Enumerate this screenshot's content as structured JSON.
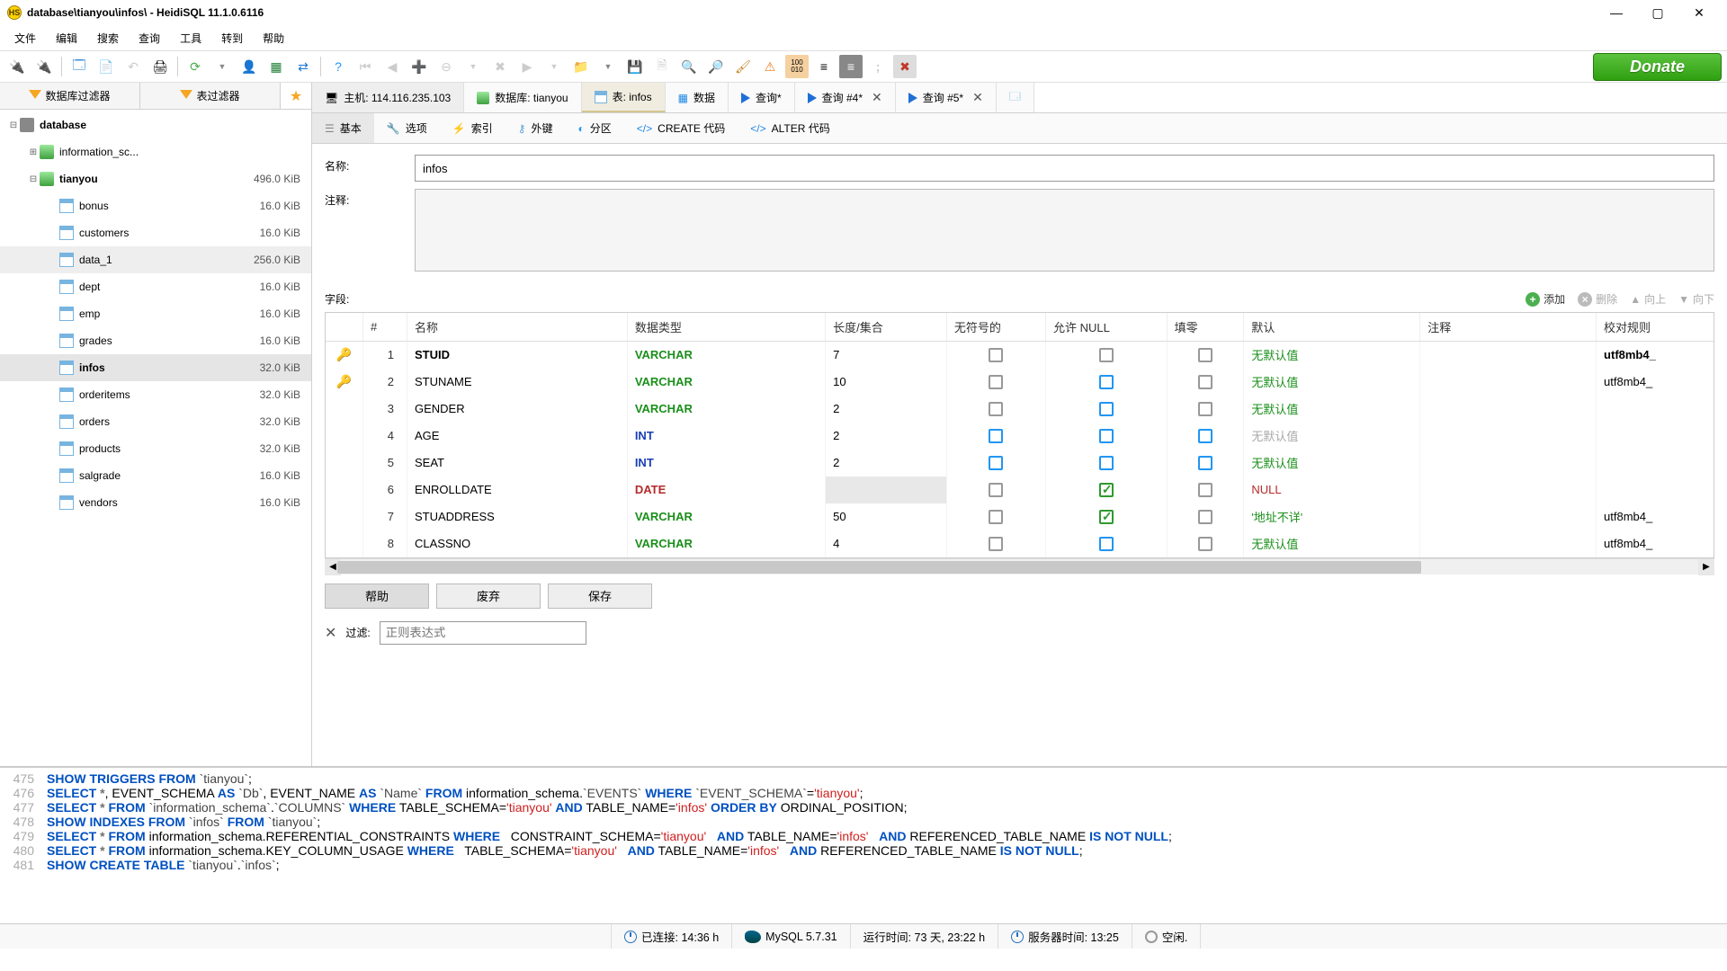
{
  "window": {
    "title": "database\\tianyou\\infos\\ - HeidiSQL 11.1.0.6116"
  },
  "menu": [
    "文件",
    "编辑",
    "搜索",
    "查询",
    "工具",
    "转到",
    "帮助"
  ],
  "donate": "Donate",
  "filter_tabs": {
    "db": "数据库过滤器",
    "tbl": "表过滤器"
  },
  "tree": {
    "root": "database",
    "children": [
      {
        "name": "information_sc...",
        "size": ""
      },
      {
        "name": "tianyou",
        "size": "496.0 KiB",
        "open": true,
        "bold": true,
        "children": [
          {
            "name": "bonus",
            "size": "16.0 KiB"
          },
          {
            "name": "customers",
            "size": "16.0 KiB"
          },
          {
            "name": "data_1",
            "size": "256.0 KiB",
            "hl": true
          },
          {
            "name": "dept",
            "size": "16.0 KiB"
          },
          {
            "name": "emp",
            "size": "16.0 KiB"
          },
          {
            "name": "grades",
            "size": "16.0 KiB"
          },
          {
            "name": "infos",
            "size": "32.0 KiB",
            "sel": true,
            "bold": true
          },
          {
            "name": "orderitems",
            "size": "32.0 KiB"
          },
          {
            "name": "orders",
            "size": "32.0 KiB"
          },
          {
            "name": "products",
            "size": "32.0 KiB"
          },
          {
            "name": "salgrade",
            "size": "16.0 KiB"
          },
          {
            "name": "vendors",
            "size": "16.0 KiB"
          }
        ]
      }
    ]
  },
  "main_tabs": {
    "host": "主机: 114.116.235.103",
    "db": "数据库: tianyou",
    "table": "表: infos",
    "data": "数据",
    "q1": "查询*",
    "q2": "查询 #4*",
    "q3": "查询 #5*"
  },
  "sub_tabs": [
    "基本",
    "选项",
    "索引",
    "外键",
    "分区",
    "CREATE 代码",
    "ALTER 代码"
  ],
  "form": {
    "name_label": "名称:",
    "name_value": "infos",
    "comment_label": "注释:",
    "comment_value": ""
  },
  "fields_toolbar": {
    "label": "字段:",
    "add": "添加",
    "del": "删除",
    "up": "向上",
    "down": "向下"
  },
  "grid": {
    "headers": [
      "#",
      "名称",
      "数据类型",
      "长度/集合",
      "无符号的",
      "允许 NULL",
      "填零",
      "默认",
      "注释",
      "校对规则"
    ],
    "rows": [
      {
        "key": "gold",
        "n": "1",
        "name": "STUID",
        "type": "VARCHAR",
        "tclass": "varchar",
        "len": "7",
        "uns": "g",
        "null": "g",
        "zero": "g",
        "def": "无默认值",
        "dclass": "def-noval",
        "pk": true,
        "coll": "utf8mb4_"
      },
      {
        "key": "red",
        "n": "2",
        "name": "STUNAME",
        "type": "VARCHAR",
        "tclass": "varchar",
        "len": "10",
        "uns": "g",
        "null": "b",
        "zero": "g",
        "def": "无默认值",
        "dclass": "def-noval",
        "coll": "utf8mb4_"
      },
      {
        "key": "",
        "n": "3",
        "name": "GENDER",
        "type": "VARCHAR",
        "tclass": "varchar",
        "len": "2",
        "uns": "g",
        "null": "b",
        "zero": "g",
        "def": "无默认值",
        "dclass": "def-noval",
        "coll": ""
      },
      {
        "key": "",
        "n": "4",
        "name": "AGE",
        "type": "INT",
        "tclass": "int",
        "len": "2",
        "uns": "b",
        "null": "b",
        "zero": "b",
        "def": "无默认值",
        "dclass": "def-gray",
        "coll": ""
      },
      {
        "key": "",
        "n": "5",
        "name": "SEAT",
        "type": "INT",
        "tclass": "int",
        "len": "2",
        "uns": "b",
        "null": "b",
        "zero": "b",
        "def": "无默认值",
        "dclass": "def-noval",
        "coll": ""
      },
      {
        "key": "",
        "n": "6",
        "name": "ENROLLDATE",
        "type": "DATE",
        "tclass": "date",
        "len": "",
        "uns": "g",
        "null": "chk",
        "zero": "g",
        "def": "NULL",
        "dclass": "def-null",
        "sel": true,
        "coll": ""
      },
      {
        "key": "",
        "n": "7",
        "name": "STUADDRESS",
        "type": "VARCHAR",
        "tclass": "varchar",
        "len": "50",
        "uns": "g",
        "null": "chk",
        "zero": "g",
        "def": "'地址不详'",
        "dclass": "def-noval",
        "coll": "utf8mb4_"
      },
      {
        "key": "",
        "n": "8",
        "name": "CLASSNO",
        "type": "VARCHAR",
        "tclass": "varchar",
        "len": "4",
        "uns": "g",
        "null": "b",
        "zero": "g",
        "def": "无默认值",
        "dclass": "def-noval",
        "coll": "utf8mb4_"
      }
    ]
  },
  "buttons": {
    "help": "帮助",
    "discard": "废弃",
    "save": "保存"
  },
  "filter": {
    "label": "过滤:",
    "placeholder": "正则表达式"
  },
  "sql": [
    {
      "n": "475",
      "t": "SHOW TRIGGERS FROM `tianyou`;"
    },
    {
      "n": "476",
      "t": "SELECT *, EVENT_SCHEMA AS `Db`, EVENT_NAME AS `Name` FROM information_schema.`EVENTS` WHERE `EVENT_SCHEMA`='tianyou';"
    },
    {
      "n": "477",
      "t": "SELECT * FROM `information_schema`.`COLUMNS` WHERE TABLE_SCHEMA='tianyou' AND TABLE_NAME='infos' ORDER BY ORDINAL_POSITION;"
    },
    {
      "n": "478",
      "t": "SHOW INDEXES FROM `infos` FROM `tianyou`;"
    },
    {
      "n": "479",
      "t": "SELECT * FROM information_schema.REFERENTIAL_CONSTRAINTS WHERE   CONSTRAINT_SCHEMA='tianyou'   AND TABLE_NAME='infos'   AND REFERENCED_TABLE_NAME IS NOT NULL;"
    },
    {
      "n": "480",
      "t": "SELECT * FROM information_schema.KEY_COLUMN_USAGE WHERE   TABLE_SCHEMA='tianyou'   AND TABLE_NAME='infos'   AND REFERENCED_TABLE_NAME IS NOT NULL;"
    },
    {
      "n": "481",
      "t": "SHOW CREATE TABLE `tianyou`.`infos`;"
    }
  ],
  "status": {
    "connected": "已连接: 14:36 h",
    "server": "MySQL 5.7.31",
    "uptime": "运行时间: 73 天, 23:22 h",
    "servertime": "服务器时间: 13:25",
    "idle": "空闲."
  }
}
